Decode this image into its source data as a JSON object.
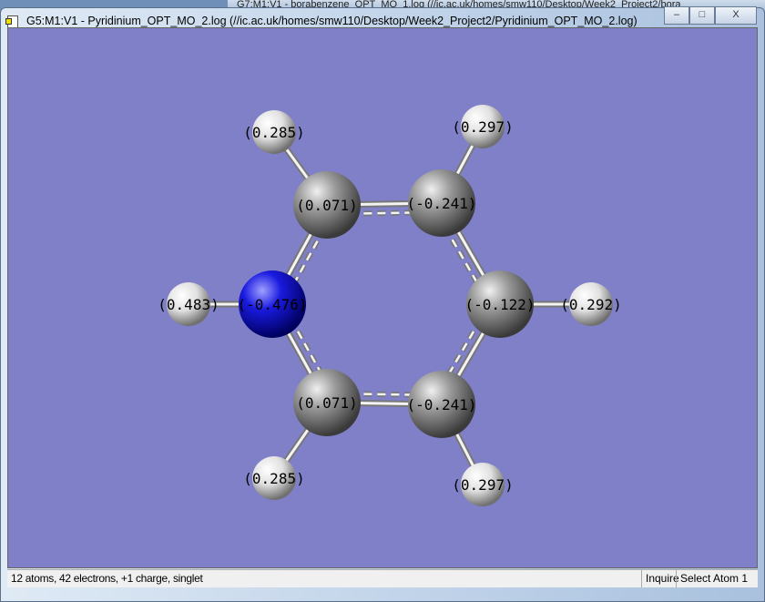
{
  "background_window": {
    "title": "G7:M1:V1 - borabenzene_OPT_MO_1.log (//ic.ac.uk/homes/smw110/Desktop/Week2_Project2/bora"
  },
  "window": {
    "title": "G5:M1:V1 - Pyridinium_OPT_MO_2.log (//ic.ac.uk/homes/smw110/Desktop/Week2_Project2/Pyridinium_OPT_MO_2.log)",
    "minimize": "–",
    "maximize": "□",
    "close": "X"
  },
  "viewer": {
    "background": "#8080c8",
    "atoms": [
      {
        "element": "H",
        "charge": "(0.285)"
      },
      {
        "element": "C",
        "charge": "(0.071)"
      },
      {
        "element": "C",
        "charge": "(-0.241)"
      },
      {
        "element": "H",
        "charge": "(0.297)"
      },
      {
        "element": "N",
        "charge": "(-0.476)"
      },
      {
        "element": "H",
        "charge": "(0.483)"
      },
      {
        "element": "C",
        "charge": "(-0.122)"
      },
      {
        "element": "H",
        "charge": "(0.292)"
      },
      {
        "element": "C",
        "charge": "(0.071)"
      },
      {
        "element": "C",
        "charge": "(-0.241)"
      },
      {
        "element": "H",
        "charge": "(0.285)"
      },
      {
        "element": "H",
        "charge": "(0.297)"
      }
    ],
    "bonds": [
      [
        0,
        1,
        "single"
      ],
      [
        1,
        2,
        "aromatic"
      ],
      [
        2,
        3,
        "single"
      ],
      [
        1,
        4,
        "aromatic"
      ],
      [
        4,
        5,
        "single"
      ],
      [
        2,
        6,
        "aromatic"
      ],
      [
        6,
        7,
        "single"
      ],
      [
        4,
        8,
        "aromatic"
      ],
      [
        6,
        9,
        "aromatic"
      ],
      [
        8,
        9,
        "aromatic"
      ],
      [
        8,
        10,
        "single"
      ],
      [
        9,
        11,
        "single"
      ]
    ],
    "colors": {
      "C": "#8a8a8a",
      "N": "#1a1adc",
      "H": "#e8e8e8"
    }
  },
  "status": {
    "summary": "12 atoms, 42 electrons, +1 charge, singlet",
    "mode": "Inquire",
    "action": "Select Atom 1"
  }
}
